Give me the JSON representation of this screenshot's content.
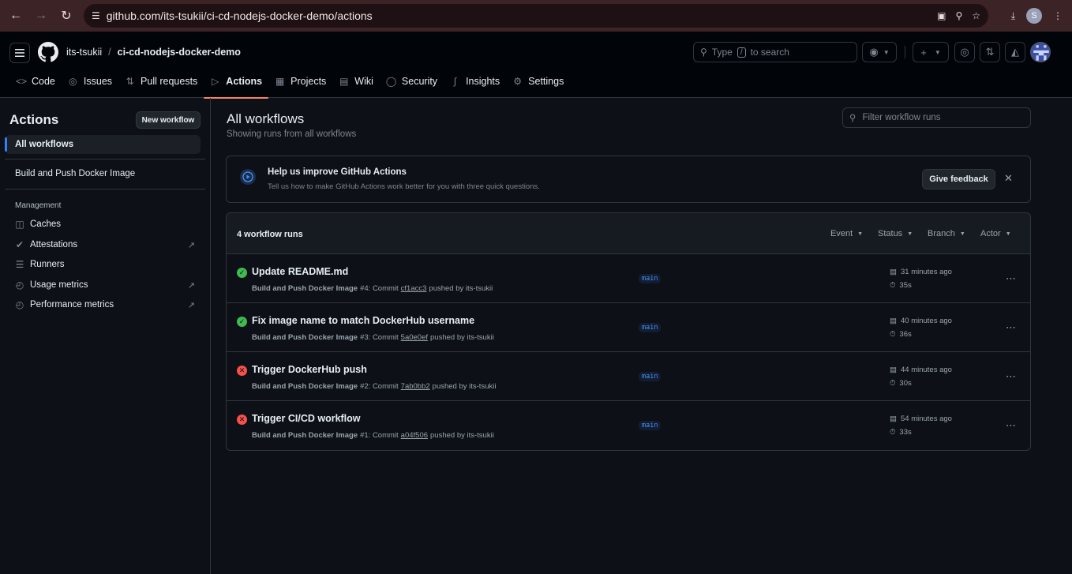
{
  "browser": {
    "url": "github.com/its-tsukii/ci-cd-nodejs-docker-demo/actions",
    "profile_initial": "S"
  },
  "header": {
    "owner": "its-tsukii",
    "separator": "/",
    "repo": "ci-cd-nodejs-docker-demo",
    "search": {
      "prefix": "Type",
      "key": "/",
      "suffix": "to search"
    }
  },
  "tabs": [
    {
      "label": "Code",
      "icon": "code-icon"
    },
    {
      "label": "Issues",
      "icon": "issue-icon"
    },
    {
      "label": "Pull requests",
      "icon": "pull-request-icon"
    },
    {
      "label": "Actions",
      "icon": "play-icon",
      "active": true
    },
    {
      "label": "Projects",
      "icon": "table-icon"
    },
    {
      "label": "Wiki",
      "icon": "book-icon"
    },
    {
      "label": "Security",
      "icon": "shield-icon"
    },
    {
      "label": "Insights",
      "icon": "graph-icon"
    },
    {
      "label": "Settings",
      "icon": "gear-icon"
    }
  ],
  "sidebar": {
    "title": "Actions",
    "new_workflow": "New workflow",
    "all_workflows": "All workflows",
    "workflows": [
      "Build and Push Docker Image"
    ],
    "management_label": "Management",
    "management": [
      {
        "label": "Caches",
        "icon": "cache-icon",
        "external": false
      },
      {
        "label": "Attestations",
        "icon": "check-circle-icon",
        "external": true
      },
      {
        "label": "Runners",
        "icon": "server-icon",
        "external": false
      },
      {
        "label": "Usage metrics",
        "icon": "meter-icon",
        "external": true
      },
      {
        "label": "Performance metrics",
        "icon": "meter-icon",
        "external": true
      }
    ]
  },
  "main": {
    "title": "All workflows",
    "subtitle": "Showing runs from all workflows",
    "filter_placeholder": "Filter workflow runs",
    "feedback": {
      "title": "Help us improve GitHub Actions",
      "description": "Tell us how to make GitHub Actions work better for you with three quick questions.",
      "button": "Give feedback"
    },
    "runs_count": "4 workflow runs",
    "filters": [
      "Event",
      "Status",
      "Branch",
      "Actor"
    ],
    "runs": [
      {
        "status": "success",
        "title": "Update README.md",
        "workflow": "Build and Push Docker Image",
        "number": "#4",
        "commit_label": ": Commit",
        "sha": "cf1acc3",
        "pushed_by": "pushed by its-tsukii",
        "branch": "main",
        "when": "31 minutes ago",
        "duration": "35s"
      },
      {
        "status": "success",
        "title": "Fix image name to match DockerHub username",
        "workflow": "Build and Push Docker Image",
        "number": "#3",
        "commit_label": ": Commit",
        "sha": "5a0e0ef",
        "pushed_by": "pushed by its-tsukii",
        "branch": "main",
        "when": "40 minutes ago",
        "duration": "36s"
      },
      {
        "status": "failure",
        "title": "Trigger DockerHub push",
        "workflow": "Build and Push Docker Image",
        "number": "#2",
        "commit_label": ": Commit",
        "sha": "7ab0bb2",
        "pushed_by": "pushed by its-tsukii",
        "branch": "main",
        "when": "44 minutes ago",
        "duration": "30s"
      },
      {
        "status": "failure",
        "title": "Trigger CI/CD workflow",
        "workflow": "Build and Push Docker Image",
        "number": "#1",
        "commit_label": ": Commit",
        "sha": "a04f506",
        "pushed_by": "pushed by its-tsukii",
        "branch": "main",
        "when": "54 minutes ago",
        "duration": "33s"
      }
    ]
  },
  "colors": {
    "accent": "#2f81f7",
    "success": "#3fb950",
    "failure": "#f85149",
    "tab_underline": "#f78166"
  }
}
